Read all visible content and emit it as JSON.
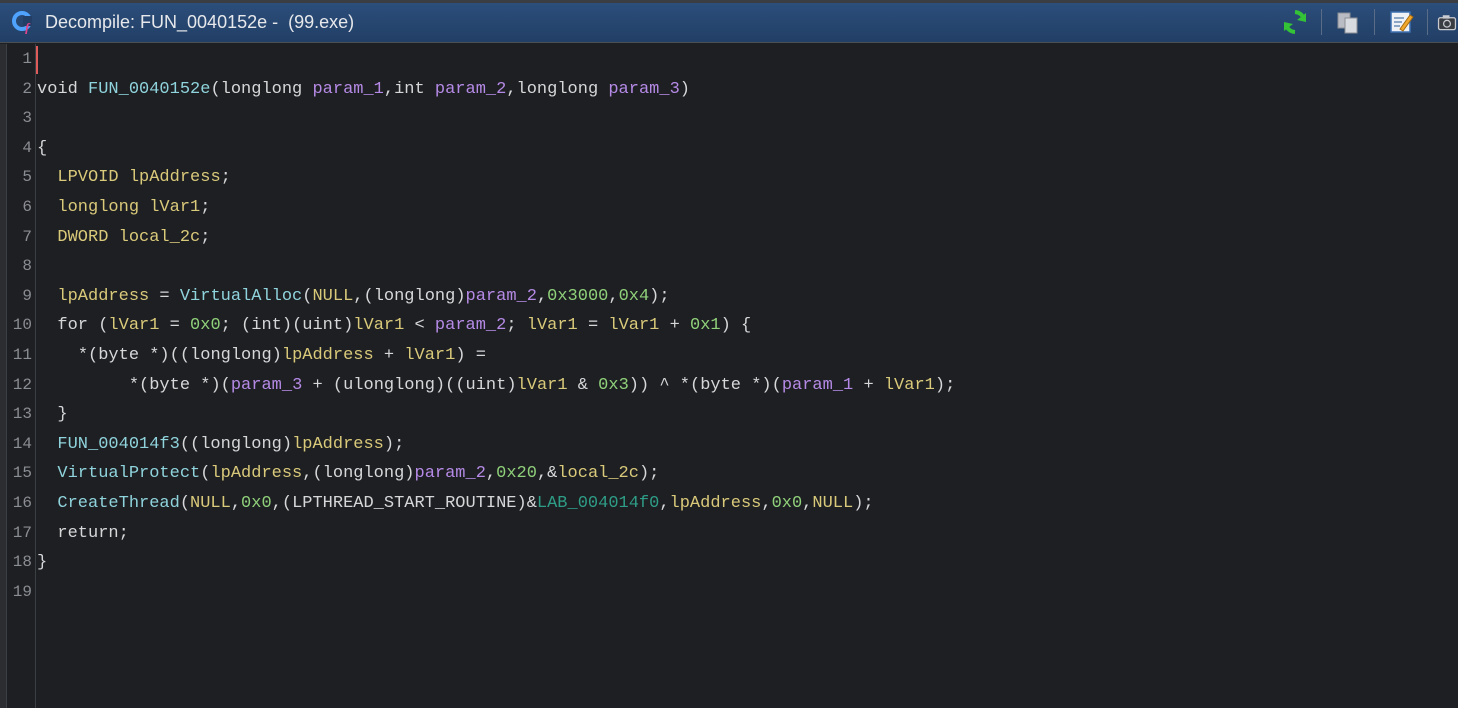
{
  "window": {
    "title": "Decompile: FUN_0040152e -  (99.exe)",
    "toolbar": [
      "refresh-icon",
      "copy-icon",
      "edit-icon",
      "snapshot-icon"
    ]
  },
  "colors": {
    "title_bg": "#2c4f7c",
    "editor_bg": "#1e1f22",
    "keyword": "#d6d7d9",
    "function": "#8fd3dc",
    "variable": "#d9c97a",
    "parameter": "#b58ae6",
    "number": "#8fd07a",
    "label": "#2e9d87"
  },
  "code": {
    "lines": [
      {
        "no": "1"
      },
      {
        "no": "2"
      },
      {
        "no": "3"
      },
      {
        "no": "4"
      },
      {
        "no": "5"
      },
      {
        "no": "6"
      },
      {
        "no": "7"
      },
      {
        "no": "8"
      },
      {
        "no": "9"
      },
      {
        "no": "10"
      },
      {
        "no": "11"
      },
      {
        "no": "12"
      },
      {
        "no": "13"
      },
      {
        "no": "14"
      },
      {
        "no": "15"
      },
      {
        "no": "16"
      },
      {
        "no": "17"
      },
      {
        "no": "18"
      },
      {
        "no": "19"
      }
    ],
    "tokens": {
      "l2": [
        [
          "kw",
          "void "
        ],
        [
          "fn",
          "FUN_0040152e"
        ],
        [
          "punc",
          "("
        ],
        [
          "kw",
          "longlong "
        ],
        [
          "param",
          "param_1"
        ],
        [
          "punc",
          ","
        ],
        [
          "kw",
          "int "
        ],
        [
          "param",
          "param_2"
        ],
        [
          "punc",
          ","
        ],
        [
          "kw",
          "longlong "
        ],
        [
          "param",
          "param_3"
        ],
        [
          "punc",
          ")"
        ]
      ],
      "l4": [
        [
          "punc",
          "{"
        ]
      ],
      "l5": [
        [
          "kw",
          "  "
        ],
        [
          "var",
          "LPVOID "
        ],
        [
          "var",
          "lpAddress"
        ],
        [
          "punc",
          ";"
        ]
      ],
      "l6": [
        [
          "kw",
          "  "
        ],
        [
          "var",
          "longlong "
        ],
        [
          "var",
          "lVar1"
        ],
        [
          "punc",
          ";"
        ]
      ],
      "l7": [
        [
          "kw",
          "  "
        ],
        [
          "var",
          "DWORD "
        ],
        [
          "var",
          "local_2c"
        ],
        [
          "punc",
          ";"
        ]
      ],
      "l9": [
        [
          "kw",
          "  "
        ],
        [
          "var",
          "lpAddress"
        ],
        [
          "punc",
          " = "
        ],
        [
          "fn",
          "VirtualAlloc"
        ],
        [
          "punc",
          "("
        ],
        [
          "var",
          "NULL"
        ],
        [
          "punc",
          ",("
        ],
        [
          "kw",
          "longlong"
        ],
        [
          "punc",
          ")"
        ],
        [
          "param",
          "param_2"
        ],
        [
          "punc",
          ","
        ],
        [
          "num",
          "0x3000"
        ],
        [
          "punc",
          ","
        ],
        [
          "num",
          "0x4"
        ],
        [
          "punc",
          ");"
        ]
      ],
      "l10": [
        [
          "kw",
          "  for "
        ],
        [
          "punc",
          "("
        ],
        [
          "var",
          "lVar1"
        ],
        [
          "punc",
          " = "
        ],
        [
          "num",
          "0x0"
        ],
        [
          "punc",
          "; ("
        ],
        [
          "kw",
          "int"
        ],
        [
          "punc",
          ")("
        ],
        [
          "kw",
          "uint"
        ],
        [
          "punc",
          ")"
        ],
        [
          "var",
          "lVar1"
        ],
        [
          "punc",
          " < "
        ],
        [
          "param",
          "param_2"
        ],
        [
          "punc",
          "; "
        ],
        [
          "var",
          "lVar1"
        ],
        [
          "punc",
          " = "
        ],
        [
          "var",
          "lVar1"
        ],
        [
          "punc",
          " + "
        ],
        [
          "num",
          "0x1"
        ],
        [
          "punc",
          ") {"
        ]
      ],
      "l11": [
        [
          "kw",
          "    "
        ],
        [
          "punc",
          "*("
        ],
        [
          "kw",
          "byte "
        ],
        [
          "punc",
          "*)(("
        ],
        [
          "kw",
          "longlong"
        ],
        [
          "punc",
          ")"
        ],
        [
          "var",
          "lpAddress"
        ],
        [
          "punc",
          " + "
        ],
        [
          "var",
          "lVar1"
        ],
        [
          "punc",
          ") ="
        ]
      ],
      "l12": [
        [
          "kw",
          "         "
        ],
        [
          "punc",
          "*("
        ],
        [
          "kw",
          "byte "
        ],
        [
          "punc",
          "*)("
        ],
        [
          "param",
          "param_3"
        ],
        [
          "punc",
          " + ("
        ],
        [
          "kw",
          "ulonglong"
        ],
        [
          "punc",
          ")(("
        ],
        [
          "kw",
          "uint"
        ],
        [
          "punc",
          ")"
        ],
        [
          "var",
          "lVar1"
        ],
        [
          "punc",
          " & "
        ],
        [
          "num",
          "0x3"
        ],
        [
          "punc",
          ")) ^ *("
        ],
        [
          "kw",
          "byte "
        ],
        [
          "punc",
          "*)("
        ],
        [
          "param",
          "param_1"
        ],
        [
          "punc",
          " + "
        ],
        [
          "var",
          "lVar1"
        ],
        [
          "punc",
          ");"
        ]
      ],
      "l13": [
        [
          "kw",
          "  "
        ],
        [
          "punc",
          "}"
        ]
      ],
      "l14": [
        [
          "kw",
          "  "
        ],
        [
          "fn",
          "FUN_004014f3"
        ],
        [
          "punc",
          "(("
        ],
        [
          "kw",
          "longlong"
        ],
        [
          "punc",
          ")"
        ],
        [
          "var",
          "lpAddress"
        ],
        [
          "punc",
          ");"
        ]
      ],
      "l15": [
        [
          "kw",
          "  "
        ],
        [
          "fn",
          "VirtualProtect"
        ],
        [
          "punc",
          "("
        ],
        [
          "var",
          "lpAddress"
        ],
        [
          "punc",
          ",("
        ],
        [
          "kw",
          "longlong"
        ],
        [
          "punc",
          ")"
        ],
        [
          "param",
          "param_2"
        ],
        [
          "punc",
          ","
        ],
        [
          "num",
          "0x20"
        ],
        [
          "punc",
          ",&"
        ],
        [
          "var",
          "local_2c"
        ],
        [
          "punc",
          ");"
        ]
      ],
      "l16": [
        [
          "kw",
          "  "
        ],
        [
          "fn",
          "CreateThread"
        ],
        [
          "punc",
          "("
        ],
        [
          "var",
          "NULL"
        ],
        [
          "punc",
          ","
        ],
        [
          "num",
          "0x0"
        ],
        [
          "punc",
          ",("
        ],
        [
          "kw",
          "LPTHREAD_START_ROUTINE"
        ],
        [
          "punc",
          ")&"
        ],
        [
          "lab",
          "LAB_004014f0"
        ],
        [
          "punc",
          ","
        ],
        [
          "var",
          "lpAddress"
        ],
        [
          "punc",
          ","
        ],
        [
          "num",
          "0x0"
        ],
        [
          "punc",
          ","
        ],
        [
          "var",
          "NULL"
        ],
        [
          "punc",
          ");"
        ]
      ],
      "l17": [
        [
          "kw",
          "  return"
        ],
        [
          "punc",
          ";"
        ]
      ],
      "l18": [
        [
          "punc",
          "}"
        ]
      ]
    }
  }
}
